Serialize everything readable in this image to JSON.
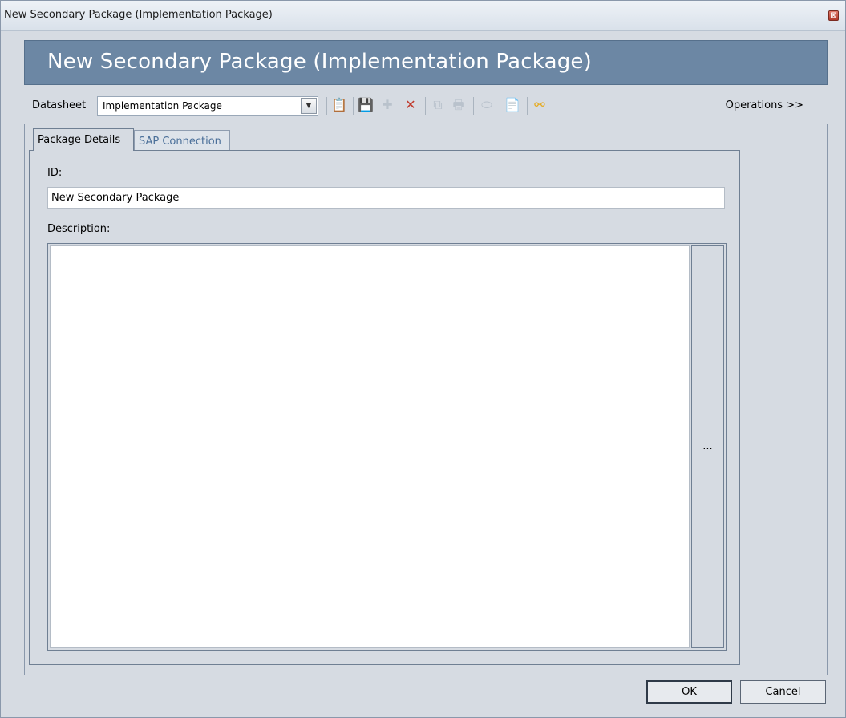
{
  "window": {
    "title": "New Secondary Package (Implementation Package)",
    "close_glyph": "⊠"
  },
  "banner": {
    "title": "New Secondary Package (Implementation Package)"
  },
  "toolbar": {
    "datasheet_label": "Datasheet",
    "datasheet_value": "Implementation Package",
    "dropdown_glyph": "▼",
    "operations_label": "Operations >>",
    "icons": {
      "paste": "📋",
      "save": "💾",
      "new": "✚",
      "delete": "✕",
      "copy": "⧉",
      "print": "🖶",
      "send": "⬭",
      "report": "📄",
      "share": "⚯"
    }
  },
  "tabs": [
    {
      "label": "Package Details",
      "active": true
    },
    {
      "label": "SAP Connection",
      "active": false
    }
  ],
  "form": {
    "id_label": "ID:",
    "id_value": "New Secondary Package",
    "description_label": "Description:",
    "description_value": "",
    "ellipsis_label": "...",
    "scroll_up": "▲",
    "scroll_down": "▼"
  },
  "buttons": {
    "ok": "OK",
    "cancel": "Cancel"
  },
  "colors": {
    "banner": "#6c87a4",
    "window_bg": "#d6dbe2",
    "tab_inactive_text": "#4a6f99",
    "delete_icon": "#c0392b",
    "share_icon": "#e6a817"
  }
}
